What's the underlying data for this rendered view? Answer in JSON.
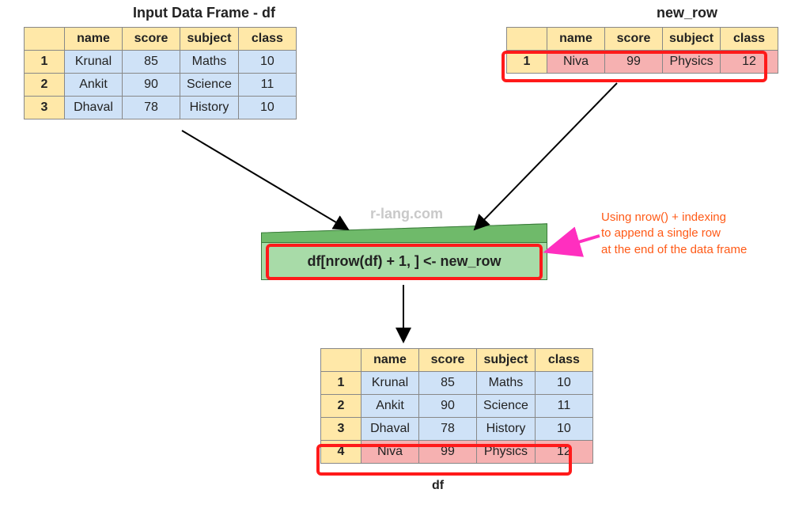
{
  "watermark": "r-lang.com",
  "input": {
    "title": "Input Data Frame - df",
    "columns": [
      "name",
      "score",
      "subject",
      "class"
    ],
    "rows": [
      {
        "idx": "1",
        "cells": [
          "Krunal",
          "85",
          "Maths",
          "10"
        ]
      },
      {
        "idx": "2",
        "cells": [
          "Ankit",
          "90",
          "Science",
          "11"
        ]
      },
      {
        "idx": "3",
        "cells": [
          "Dhaval",
          "78",
          "History",
          "10"
        ]
      }
    ]
  },
  "new_row": {
    "title": "new_row",
    "columns": [
      "name",
      "score",
      "subject",
      "class"
    ],
    "rows": [
      {
        "idx": "1",
        "cells": [
          "Niva",
          "99",
          "Physics",
          "12"
        ]
      }
    ]
  },
  "code": "df[nrow(df) + 1, ] <- new_row",
  "annotation": {
    "line1": "Using nrow() + indexing",
    "line2": "to append a single row",
    "line3": "at the end of the data frame"
  },
  "output": {
    "caption": "df",
    "columns": [
      "name",
      "score",
      "subject",
      "class"
    ],
    "rows": [
      {
        "idx": "1",
        "cells": [
          "Krunal",
          "85",
          "Maths",
          "10"
        ]
      },
      {
        "idx": "2",
        "cells": [
          "Ankit",
          "90",
          "Science",
          "11"
        ]
      },
      {
        "idx": "3",
        "cells": [
          "Dhaval",
          "78",
          "History",
          "10"
        ]
      },
      {
        "idx": "4",
        "cells": [
          "Niva",
          "99",
          "Physics",
          "12"
        ],
        "hot": true
      }
    ]
  }
}
